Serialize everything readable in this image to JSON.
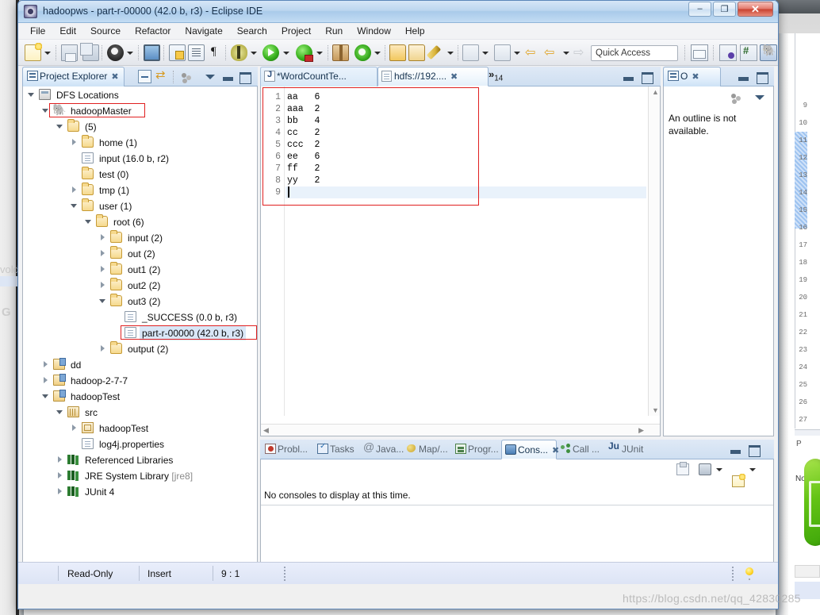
{
  "window": {
    "title": "hadoopws - part-r-00000 (42.0 b, r3) - Eclipse IDE",
    "icon": "eclipse-icon",
    "minimize_label": "–",
    "maximize_label": "❐",
    "close_label": "✕"
  },
  "menubar": {
    "items": [
      {
        "label": "File"
      },
      {
        "label": "Edit"
      },
      {
        "label": "Source"
      },
      {
        "label": "Refactor"
      },
      {
        "label": "Navigate"
      },
      {
        "label": "Search"
      },
      {
        "label": "Project"
      },
      {
        "label": "Run"
      },
      {
        "label": "Window"
      },
      {
        "label": "Help"
      }
    ]
  },
  "toolbar": {
    "quick_access_placeholder": "Quick Access",
    "quick_access_value": "",
    "icons": [
      "new-wizard-icon",
      "save-icon",
      "save-all-icon",
      "toggle-user-icon",
      "open-console-icon",
      "open-type-icon",
      "open-task-icon",
      "pilcrow-icon",
      "debug-icon",
      "run-icon",
      "run-external-icon",
      "new-package-icon",
      "refresh-icon",
      "open-folder-icon",
      "import-folder-icon",
      "edit-pen-icon",
      "key-icon",
      "step-into-icon",
      "step-out-icon",
      "back-icon",
      "forward-icon",
      "next-annotation-icon"
    ],
    "perspective_icons": [
      "new-perspective-icon",
      "java-perspective-icon",
      "jre-perspective-icon",
      "hadoop-perspective-icon"
    ]
  },
  "explorer": {
    "tab_label": "Project Explorer",
    "tab_close": "✖",
    "toolbar_icons": [
      "collapse-all-icon",
      "link-with-editor-icon",
      "view-filters-icon",
      "view-menu-icon",
      "minimize-icon",
      "maximize-icon"
    ],
    "tree": [
      {
        "label": "DFS Locations",
        "indent": 0,
        "icon": "dfs-locations-icon",
        "twisty": "open"
      },
      {
        "label": "hadoopMaster",
        "indent": 1,
        "icon": "hadoop-elephant-icon",
        "twisty": "open",
        "highlight": "red-box"
      },
      {
        "label": "(5)",
        "indent": 2,
        "icon": "folder-icon",
        "twisty": "open"
      },
      {
        "label": "home (1)",
        "indent": 3,
        "icon": "folder-icon",
        "twisty": "closed"
      },
      {
        "label": "input (16.0 b, r2)",
        "indent": 3,
        "icon": "file-icon",
        "twisty": "none"
      },
      {
        "label": "test (0)",
        "indent": 3,
        "icon": "folder-icon",
        "twisty": "none"
      },
      {
        "label": "tmp (1)",
        "indent": 3,
        "icon": "folder-icon",
        "twisty": "closed"
      },
      {
        "label": "user (1)",
        "indent": 3,
        "icon": "folder-icon",
        "twisty": "open"
      },
      {
        "label": "root (6)",
        "indent": 4,
        "icon": "folder-icon",
        "twisty": "open"
      },
      {
        "label": "input (2)",
        "indent": 5,
        "icon": "folder-icon",
        "twisty": "closed"
      },
      {
        "label": "out (2)",
        "indent": 5,
        "icon": "folder-icon",
        "twisty": "closed"
      },
      {
        "label": "out1 (2)",
        "indent": 5,
        "icon": "folder-icon",
        "twisty": "closed"
      },
      {
        "label": "out2 (2)",
        "indent": 5,
        "icon": "folder-icon",
        "twisty": "closed"
      },
      {
        "label": "out3 (2)",
        "indent": 5,
        "icon": "folder-icon",
        "twisty": "open"
      },
      {
        "label": "_SUCCESS (0.0 b, r3)",
        "indent": 6,
        "icon": "file-icon",
        "twisty": "none"
      },
      {
        "label": "part-r-00000 (42.0 b, r3)",
        "indent": 6,
        "icon": "file-icon",
        "twisty": "none",
        "selected": true,
        "highlight": "red-box"
      },
      {
        "label": "output (2)",
        "indent": 5,
        "icon": "folder-icon",
        "twisty": "closed"
      },
      {
        "label": "dd",
        "indent": 1,
        "icon": "java-project-icon",
        "twisty": "closed"
      },
      {
        "label": "hadoop-2-7-7",
        "indent": 1,
        "icon": "java-project-icon",
        "twisty": "closed"
      },
      {
        "label": "hadoopTest",
        "indent": 1,
        "icon": "java-project-icon",
        "twisty": "open"
      },
      {
        "label": "src",
        "indent": 2,
        "icon": "source-folder-icon",
        "twisty": "open"
      },
      {
        "label": "hadoopTest",
        "indent": 3,
        "icon": "package-icon",
        "twisty": "closed"
      },
      {
        "label": "log4j.properties",
        "indent": 3,
        "icon": "file-icon",
        "twisty": "none"
      },
      {
        "label": "Referenced Libraries",
        "indent": 2,
        "icon": "library-icon",
        "twisty": "closed"
      },
      {
        "label": "JRE System Library",
        "indent": 2,
        "icon": "library-icon",
        "twisty": "closed",
        "suffix": "[jre8]"
      },
      {
        "label": "JUnit 4",
        "indent": 2,
        "icon": "library-icon",
        "twisty": "closed"
      }
    ],
    "hscroll_left": "◀",
    "hscroll_right": "▶"
  },
  "editor": {
    "tabs": [
      {
        "label": "*WordCountTe...",
        "icon": "java-file-icon",
        "active": false,
        "dirty": true
      },
      {
        "label": "hdfs://192....",
        "icon": "text-file-icon",
        "active": true,
        "close": "✖"
      }
    ],
    "overflow_label": "»",
    "overflow_count": "14",
    "minimize_icon": "minimize-icon",
    "maximize_icon": "maximize-icon",
    "lines": [
      {
        "num": "1",
        "text": "aa   6"
      },
      {
        "num": "2",
        "text": "aaa  2"
      },
      {
        "num": "3",
        "text": "bb   4"
      },
      {
        "num": "4",
        "text": "cc   2"
      },
      {
        "num": "5",
        "text": "ccc  2"
      },
      {
        "num": "6",
        "text": "ee   6"
      },
      {
        "num": "7",
        "text": "ff   2"
      },
      {
        "num": "8",
        "text": "yy   2"
      },
      {
        "num": "9",
        "text": ""
      }
    ],
    "current_line": "9"
  },
  "outline": {
    "tab_label": "O",
    "tab_icon": "outline-icon",
    "tab_close": "✖",
    "message": "An outline is not available.",
    "toolbar_icons": [
      "view-filters-icon",
      "view-menu-icon"
    ],
    "minimize_icon": "minimize-icon",
    "maximize_icon": "maximize-icon"
  },
  "console": {
    "tabs": [
      {
        "label": "Probl...",
        "icon": "problems-icon",
        "active": false
      },
      {
        "label": "Tasks",
        "icon": "tasks-icon",
        "active": false
      },
      {
        "label": "Java...",
        "icon": "javadoc-icon",
        "active": false
      },
      {
        "label": "Map/...",
        "icon": "map-reduce-icon",
        "active": false
      },
      {
        "label": "Progr...",
        "icon": "progress-icon",
        "active": false
      },
      {
        "label": "Cons...",
        "icon": "console-icon",
        "active": true,
        "close": "✖"
      },
      {
        "label": "Call ...",
        "icon": "call-hierarchy-icon",
        "active": false
      },
      {
        "label": "JUnit",
        "icon": "junit-icon",
        "active": false
      }
    ],
    "message": "No consoles to display at this time.",
    "toolbar_icons": [
      "pin-console-icon",
      "display-selected-console-icon",
      "open-console-icon"
    ],
    "minimize_icon": "minimize-icon",
    "maximize_icon": "maximize-icon"
  },
  "statusbar": {
    "writable_state": "Read-Only",
    "insert_mode": "Insert",
    "cursor_position": "9 : 1",
    "bulb_icon": "quick-fix-bulb-icon"
  },
  "watermark": "https://blog.csdn.net/qq_42830285",
  "background": {
    "left_text_1": "vold",
    "left_text_2": "G",
    "right_line_numbers": [
      "9",
      "10",
      "11",
      "12",
      "13",
      "14",
      "15",
      "16",
      "17",
      "18",
      "19",
      "20",
      "21",
      "22",
      "23",
      "24",
      "25",
      "26",
      "27"
    ],
    "right_problems_label": "P",
    "right_console_label": "No co"
  },
  "colors": {
    "accent": "#3c5a78",
    "selection": "#d9e7f7",
    "highlight_box": "#e02020",
    "current_line": "#e9f2fb",
    "titlebar": "#a9caea"
  }
}
